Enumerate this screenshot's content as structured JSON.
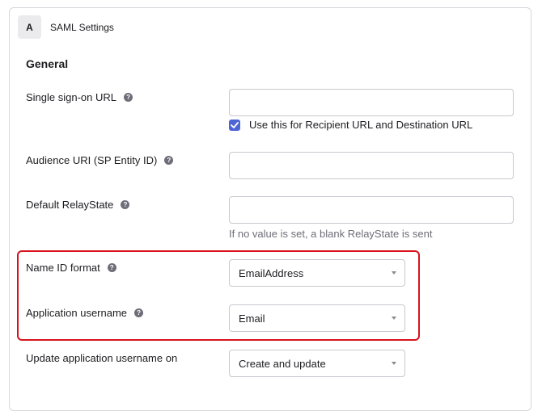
{
  "header": {
    "step": "A",
    "title": "SAML Settings"
  },
  "section": {
    "title": "General"
  },
  "fields": {
    "sso_url": {
      "label": "Single sign-on URL",
      "value": ""
    },
    "recipient_checkbox": {
      "label": "Use this for Recipient URL and Destination URL",
      "checked": true
    },
    "audience_uri": {
      "label": "Audience URI (SP Entity ID)",
      "value": ""
    },
    "relay_state": {
      "label": "Default RelayState",
      "value": "",
      "hint": "If no value is set, a blank RelayState is sent"
    },
    "name_id_format": {
      "label": "Name ID format",
      "value": "EmailAddress"
    },
    "app_username": {
      "label": "Application username",
      "value": "Email"
    },
    "update_username": {
      "label": "Update application username on",
      "value": "Create and update"
    }
  },
  "help_glyph": "?",
  "colors": {
    "accent": "#4c64d4",
    "highlight": "#d8121c"
  }
}
